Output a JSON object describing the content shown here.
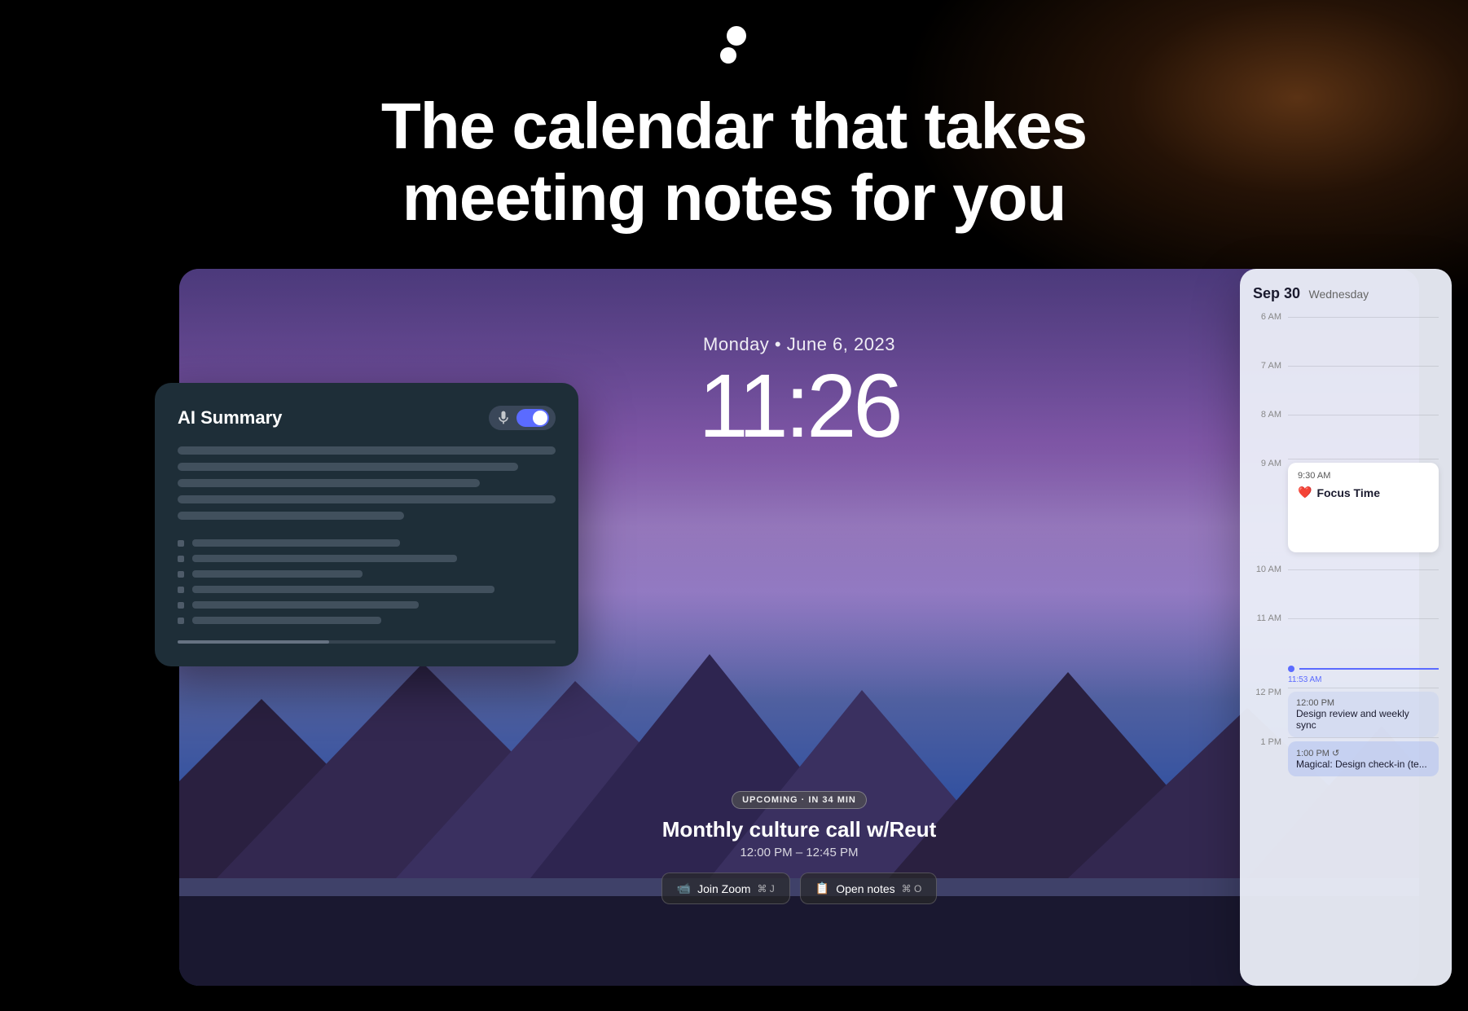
{
  "hero": {
    "title_line1": "The calendar that takes",
    "title_line2": "meeting notes for you"
  },
  "logo": {
    "alt": "Magical logo"
  },
  "clock": {
    "date": "Monday • June 6, 2023",
    "time": "11:26"
  },
  "event": {
    "badge": "UPCOMING · IN 34 MIN",
    "title": "Monthly culture call w/Reut",
    "time_range": "12:00 PM – 12:45 PM",
    "join_btn": "Join Zoom",
    "join_shortcut": "⌘ J",
    "notes_btn": "Open notes",
    "notes_shortcut": "⌘ O"
  },
  "ai_panel": {
    "title": "AI Summary",
    "toggle_on": true
  },
  "calendar": {
    "date": "Sep 30",
    "day": "Wednesday",
    "time_slots": [
      {
        "label": "6 AM"
      },
      {
        "label": "7 AM"
      },
      {
        "label": "8 AM"
      },
      {
        "label": "9 AM"
      },
      {
        "label": "10 AM"
      },
      {
        "label": "11 AM"
      },
      {
        "label": "12 PM"
      },
      {
        "label": "1 PM"
      }
    ],
    "focus_event": {
      "time": "9:30 AM",
      "title": "Focus Time",
      "emoji": "❤️"
    },
    "design_event": {
      "time": "12:00 PM",
      "title": "Design review and weekly sync"
    },
    "magical_event": {
      "time": "1:00 PM ↺",
      "title": "Magical: Design check-in (te..."
    },
    "current_time": "11:53 AM"
  }
}
